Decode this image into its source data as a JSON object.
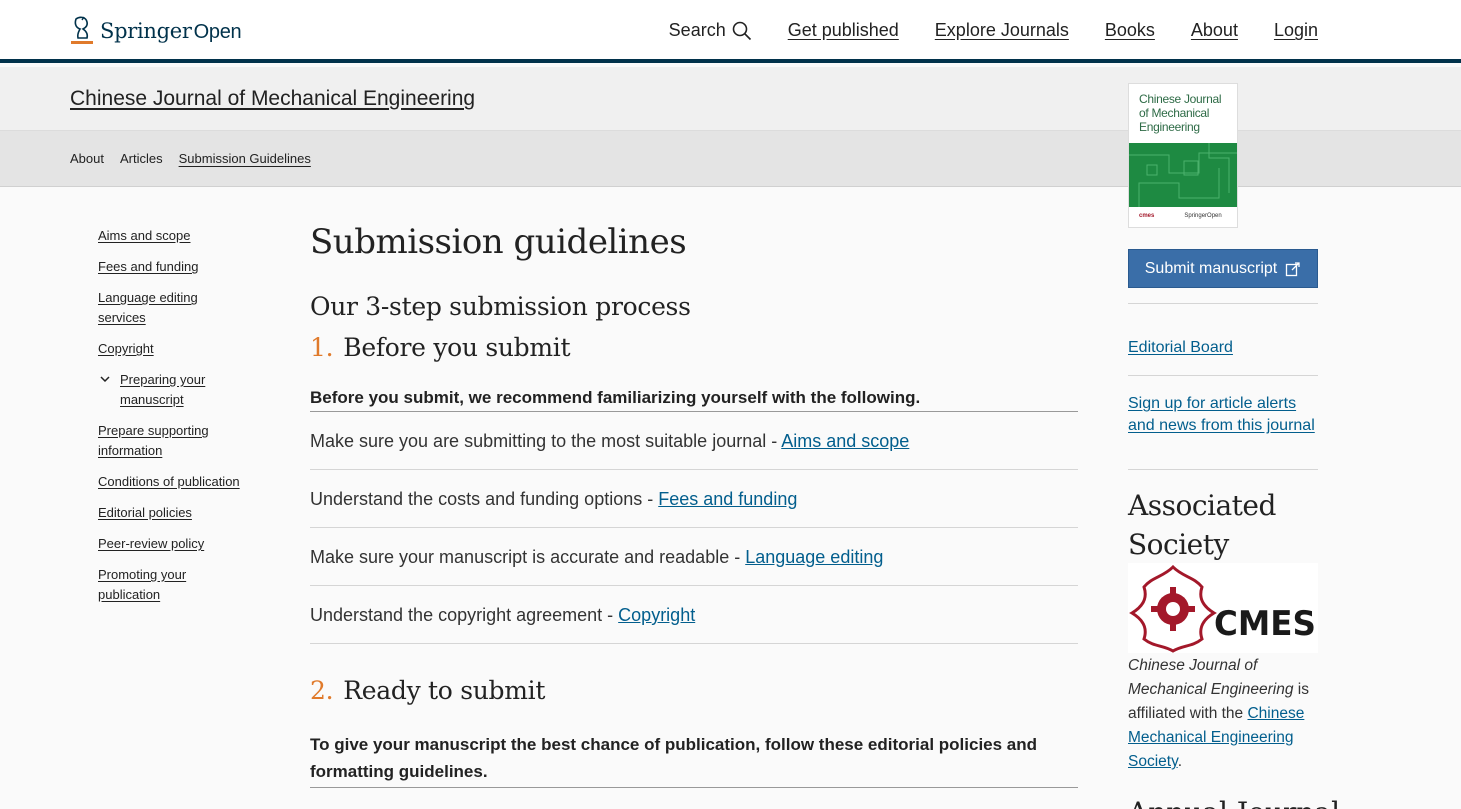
{
  "header": {
    "logo_main": "Springer",
    "logo_open": "Open",
    "search_label": "Search",
    "nav": [
      "Get published",
      "Explore Journals",
      "Books",
      "About",
      "Login"
    ]
  },
  "journal": {
    "title": "Chinese Journal of Mechanical Engineering",
    "subnav": [
      "About",
      "Articles",
      "Submission Guidelines"
    ],
    "cover_title": "Chinese Journal of Mechanical Engineering",
    "cover_left": "cmes",
    "cover_right": "SpringerOpen"
  },
  "left_nav": {
    "items": [
      "Aims and scope",
      "Fees and funding",
      "Language editing services",
      "Copyright",
      "Preparing your manuscript",
      "Prepare supporting information",
      "Conditions of publication",
      "Editorial policies",
      "Peer-review policy",
      "Promoting your publication"
    ]
  },
  "main": {
    "title": "Submission guidelines",
    "process_title": "Our 3-step submission process",
    "step1": {
      "num": "1.",
      "title": "Before you submit"
    },
    "lead1": "Before you submit, we recommend familiarizing yourself with the following.",
    "rows": [
      {
        "text": "Make sure you are submitting to the most suitable journal - ",
        "link": "Aims and scope"
      },
      {
        "text": "Understand the costs and funding options - ",
        "link": "Fees and funding"
      },
      {
        "text": "Make sure your manuscript is accurate and readable - ",
        "link": "Language editing"
      },
      {
        "text": "Understand the copyright agreement - ",
        "link": "Copyright"
      }
    ],
    "step2": {
      "num": "2.",
      "title": "Ready to submit"
    },
    "lead2": "To give your manuscript the best chance of publication, follow these editorial policies and formatting guidelines."
  },
  "right": {
    "submit_label": "Submit manuscript",
    "editorial_board": "Editorial Board",
    "alerts": "Sign up for article alerts and news from this journal",
    "assoc_title": "Associated Society",
    "cmes_text": "CMES",
    "affil_italic": "Chinese Journal of Mechanical Engineering",
    "affil_mid": " is affiliated with the ",
    "affil_link": "Chinese Mechanical Engineering Society",
    "affil_end": ".",
    "peek": "Annual Journal"
  },
  "colors": {
    "brand_dark": "#01324b",
    "link": "#025e8d",
    "accent_orange": "#e07a2b",
    "button": "#3a6ea8",
    "cmes_red": "#a3182a"
  }
}
